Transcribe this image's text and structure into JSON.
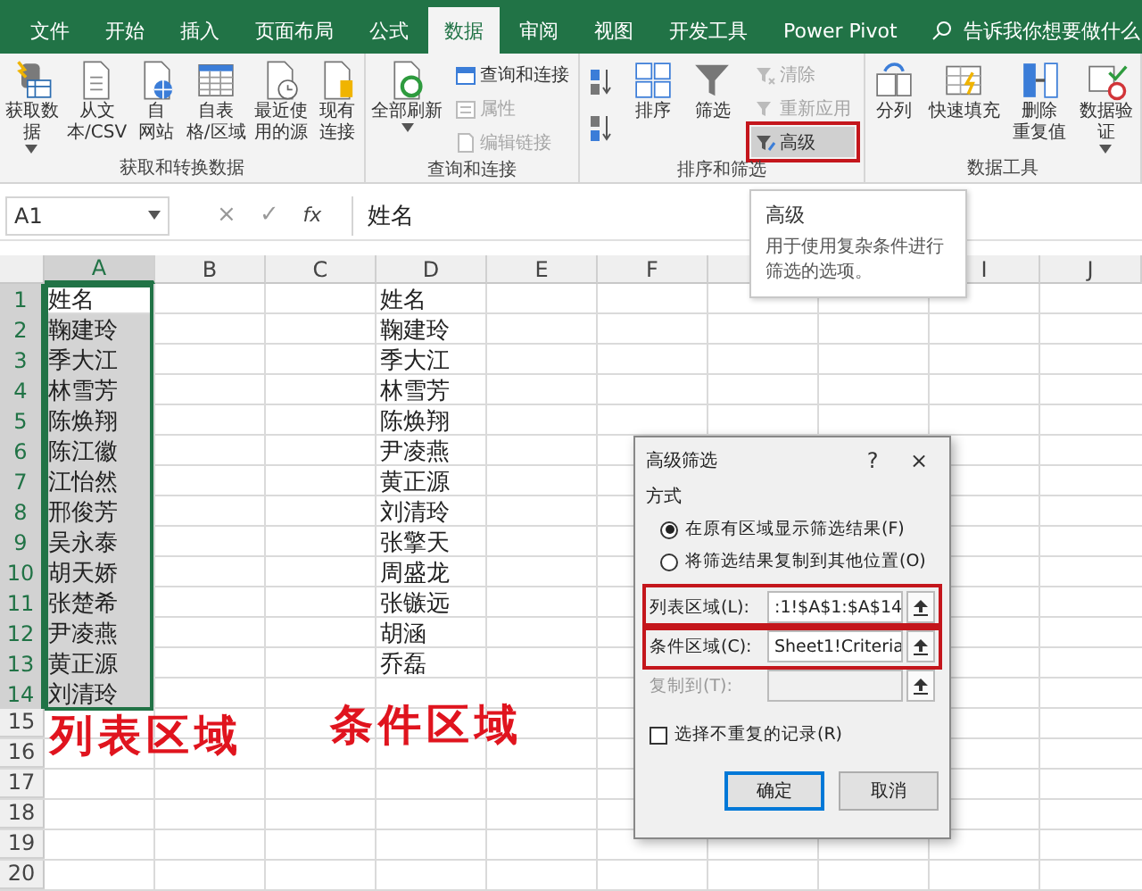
{
  "tabs": [
    {
      "label": "文件",
      "selected": false
    },
    {
      "label": "开始",
      "selected": false
    },
    {
      "label": "插入",
      "selected": false
    },
    {
      "label": "页面布局",
      "selected": false
    },
    {
      "label": "公式",
      "selected": false
    },
    {
      "label": "数据",
      "selected": true
    },
    {
      "label": "审阅",
      "selected": false
    },
    {
      "label": "视图",
      "selected": false
    },
    {
      "label": "开发工具",
      "selected": false
    },
    {
      "label": "Power Pivot",
      "selected": false
    }
  ],
  "search": {
    "placeholder": "告诉我你想要做什么"
  },
  "ribbon_groups": [
    {
      "label": "获取和转换数据",
      "items": [
        {
          "kind": "large",
          "lines": [
            "获取数",
            "据"
          ],
          "dropdown": true
        },
        {
          "kind": "large",
          "lines": [
            "从文",
            "本/CSV"
          ],
          "dropdown": false
        },
        {
          "kind": "large",
          "lines": [
            "自",
            "网站"
          ],
          "dropdown": false
        },
        {
          "kind": "large",
          "lines": [
            "自表",
            "格/区域"
          ],
          "dropdown": false
        },
        {
          "kind": "large",
          "lines": [
            "最近使",
            "用的源"
          ],
          "dropdown": false
        },
        {
          "kind": "large",
          "lines": [
            "现有",
            "连接"
          ],
          "dropdown": false
        }
      ]
    },
    {
      "label": "查询和连接",
      "items": [
        {
          "kind": "large",
          "lines": [
            "全部刷新"
          ],
          "dropdown": true
        },
        {
          "kind": "stack",
          "buttons": [
            {
              "label": "查询和连接",
              "disabled": false,
              "annotated": false
            },
            {
              "label": "属性",
              "disabled": true,
              "annotated": false
            },
            {
              "label": "编辑链接",
              "disabled": true,
              "annotated": false
            }
          ]
        }
      ]
    },
    {
      "label": "排序和筛选",
      "items": [
        {
          "kind": "sort-buttons"
        },
        {
          "kind": "large",
          "lines": [
            "排序"
          ],
          "dropdown": false
        },
        {
          "kind": "large",
          "lines": [
            "筛选"
          ],
          "dropdown": false
        },
        {
          "kind": "stack",
          "buttons": [
            {
              "label": "清除",
              "disabled": true,
              "annotated": false
            },
            {
              "label": "重新应用",
              "disabled": true,
              "annotated": false
            },
            {
              "label": "高级",
              "disabled": false,
              "annotated": true
            }
          ]
        }
      ]
    },
    {
      "label": "数据工具",
      "items": [
        {
          "kind": "large",
          "lines": [
            "分列"
          ],
          "dropdown": false
        },
        {
          "kind": "large",
          "lines": [
            "快速填充"
          ],
          "dropdown": false
        },
        {
          "kind": "large",
          "lines": [
            "删除",
            "重复值"
          ],
          "dropdown": false
        },
        {
          "kind": "large",
          "lines": [
            "数据验",
            "证"
          ],
          "dropdown": true
        }
      ]
    }
  ],
  "formula_bar": {
    "name_box": "A1",
    "buttons": [
      "×",
      "✓",
      "fx"
    ],
    "value": "姓名"
  },
  "sheet": {
    "columns": [
      {
        "letter": "A",
        "selected": true
      },
      {
        "letter": "B",
        "selected": false
      },
      {
        "letter": "C",
        "selected": false
      },
      {
        "letter": "D",
        "selected": false
      },
      {
        "letter": "E",
        "selected": false
      },
      {
        "letter": "F",
        "selected": false
      },
      {},
      {},
      {
        "letter": "I",
        "selected": false
      },
      {
        "letter": "J",
        "selected": false
      }
    ],
    "rows": [
      {
        "number": "1",
        "selected": true
      },
      {
        "number": "2",
        "selected": true
      },
      {
        "number": "3",
        "selected": true
      },
      {
        "number": "4",
        "selected": true
      },
      {
        "number": "5",
        "selected": true
      },
      {
        "number": "6",
        "selected": true
      },
      {
        "number": "7",
        "selected": true
      },
      {
        "number": "8",
        "selected": true
      },
      {
        "number": "9",
        "selected": true
      },
      {
        "number": "10",
        "selected": true
      },
      {
        "number": "11",
        "selected": true
      },
      {
        "number": "12",
        "selected": true
      },
      {
        "number": "13",
        "selected": true
      },
      {
        "number": "14",
        "selected": true
      },
      {
        "number": "15",
        "selected": false
      },
      {
        "number": "16",
        "selected": false
      },
      {
        "number": "17",
        "selected": false
      },
      {
        "number": "18",
        "selected": false
      },
      {
        "number": "19",
        "selected": false
      },
      {
        "number": "20",
        "selected": false
      }
    ],
    "column_a": [
      {
        "text": "姓名",
        "selected": false
      },
      {
        "text": "鞠建玲",
        "selected": true
      },
      {
        "text": "季大江",
        "selected": true
      },
      {
        "text": "林雪芳",
        "selected": true
      },
      {
        "text": "陈焕翔",
        "selected": true
      },
      {
        "text": "陈江徽",
        "selected": true
      },
      {
        "text": "江怡然",
        "selected": true
      },
      {
        "text": "邢俊芳",
        "selected": true
      },
      {
        "text": "吴永泰",
        "selected": true
      },
      {
        "text": "胡天娇",
        "selected": true
      },
      {
        "text": "张楚希",
        "selected": true
      },
      {
        "text": "尹凌燕",
        "selected": true
      },
      {
        "text": "黄正源",
        "selected": true
      },
      {
        "text": "刘清玲",
        "selected": true
      }
    ],
    "column_d": [
      "姓名",
      "鞠建玲",
      "季大江",
      "林雪芳",
      "陈焕翔",
      "尹凌燕",
      "黄正源",
      "刘清玲",
      "张擎天",
      "周盛龙",
      "张镞远",
      "胡涵",
      "乔磊"
    ]
  },
  "annotations": [
    "列表区域",
    "条件区域"
  ],
  "tooltip": {
    "title": "高级",
    "text": "用于使用复杂条件进行筛选的选项。"
  },
  "dialog": {
    "title": "高级筛选",
    "help": "?",
    "close": "×",
    "section": "方式",
    "radios": [
      {
        "label": "在原有区域显示筛选结果(F)",
        "selected": true
      },
      {
        "label": "将筛选结果复制到其他位置(O)",
        "selected": false
      }
    ],
    "fields": [
      {
        "label": "列表区域(L):",
        "value": ":1!$A$1:$A$14",
        "disabled": false,
        "annotated": true
      },
      {
        "label": "条件区域(C):",
        "value": "Sheet1!Criteria",
        "disabled": false,
        "annotated": true
      },
      {
        "label": "复制到(T):",
        "disabled": true,
        "annotated": false
      }
    ],
    "checkbox": {
      "label": "选择不重复的记录(R)",
      "checked": false
    },
    "buttons": [
      {
        "label": "确定",
        "default": true
      },
      {
        "label": "取消",
        "default": false
      }
    ]
  }
}
